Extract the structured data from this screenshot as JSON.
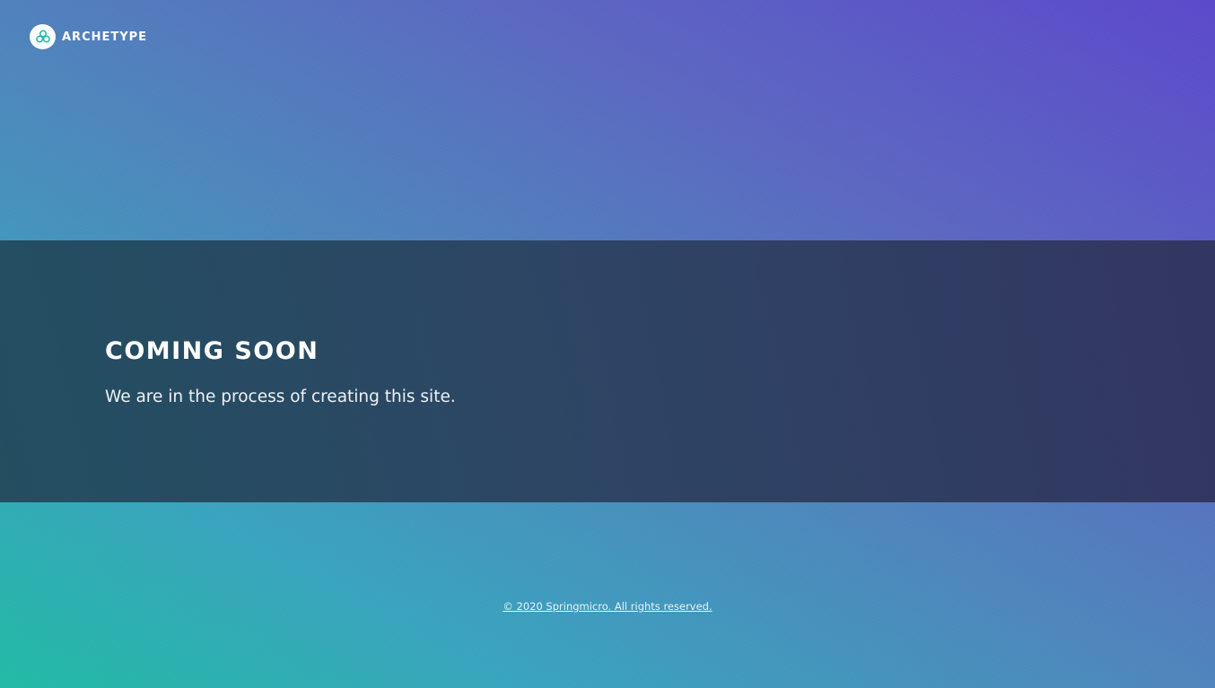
{
  "header": {
    "brand_name": "ARCHETYPE",
    "logo_icon": "molecule-icon"
  },
  "hero": {
    "title": "COMING SOON",
    "subtitle": "We are in the process of creating this site."
  },
  "footer": {
    "copyright": "© 2020 Springmicro. All rights reserved."
  },
  "colors": {
    "background_start": "#22bba6",
    "background_end": "#5c49cc",
    "band": "#2c4160",
    "logo_accent": "#2bb9ad"
  }
}
